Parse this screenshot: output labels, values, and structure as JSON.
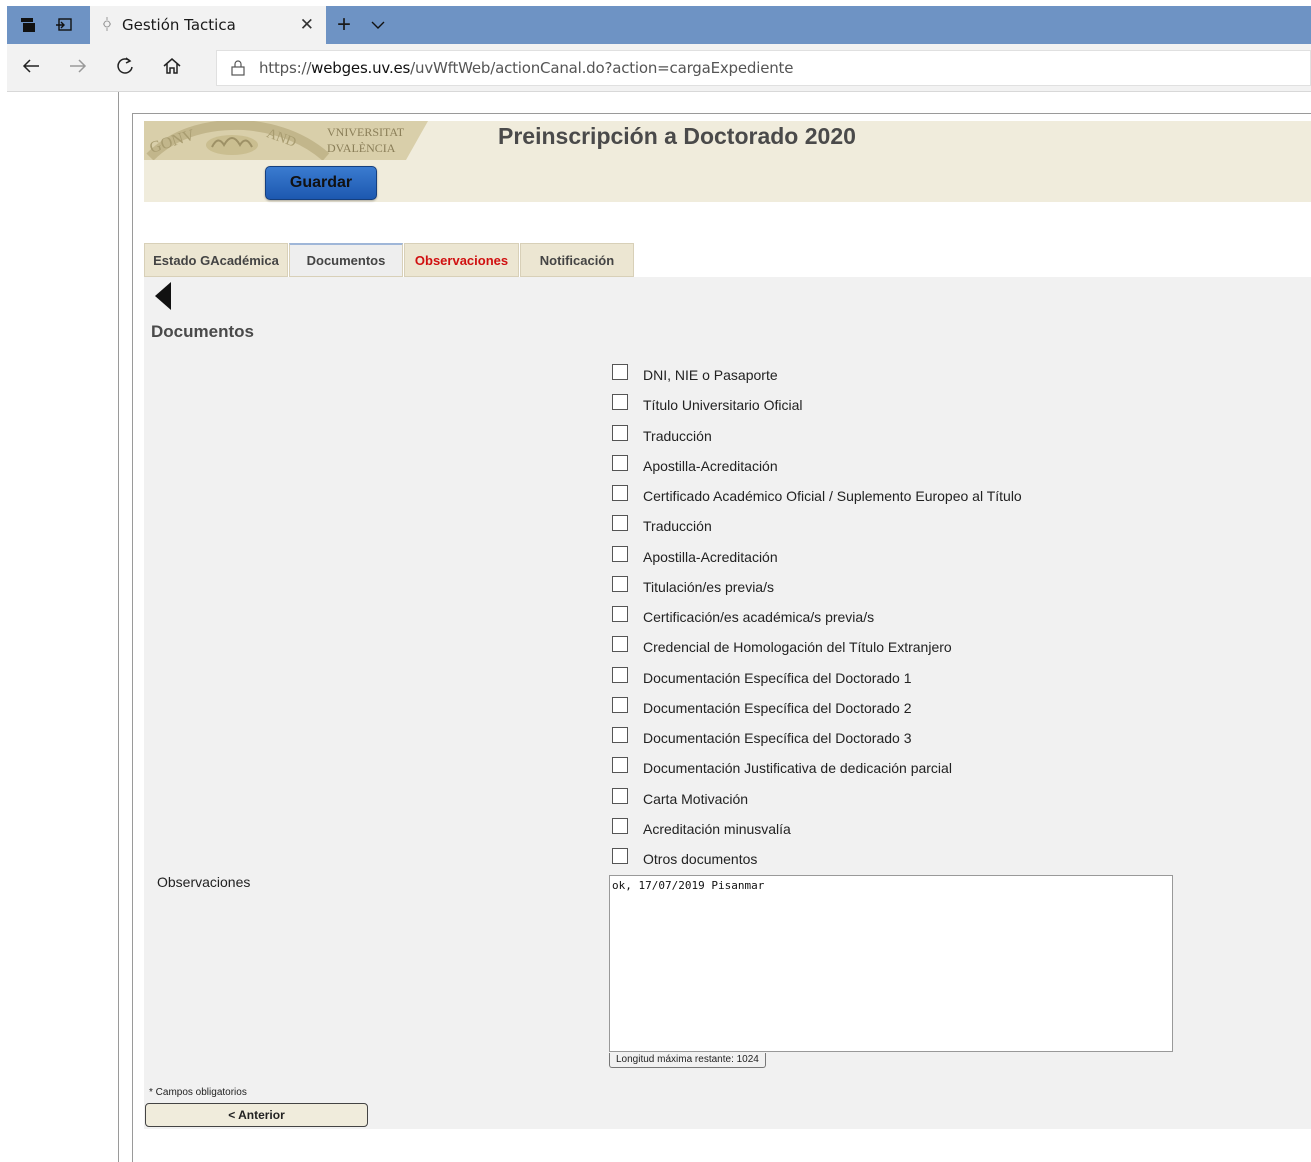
{
  "browser": {
    "tab_title": "Gestión Tactica",
    "new_tab_symbol": "+",
    "url_prefix": "https://",
    "url_host": "webges.uv.es",
    "url_path": "/uvWftWeb/actionCanal.do?action=cargaExpediente"
  },
  "header": {
    "logo_text_line1": "VNIVERSITAT",
    "logo_text_line2": "DVALÈNCIA",
    "page_title": "Preinscripción a Doctorado 2020",
    "save_label": "Guardar"
  },
  "tabs": [
    {
      "label": "Estado GAcadémica"
    },
    {
      "label": "Documentos"
    },
    {
      "label": "Observaciones"
    },
    {
      "label": "Notificación"
    }
  ],
  "section_title": "Documentos",
  "documents": [
    "DNI, NIE o Pasaporte",
    "Título Universitario Oficial",
    "Traducción",
    "Apostilla-Acreditación",
    "Certificado Académico Oficial / Suplemento Europeo al Título",
    "Traducción",
    "Apostilla-Acreditación",
    "Titulación/es previa/s",
    "Certificación/es académica/s previa/s",
    "Credencial de Homologación del Título Extranjero",
    "Documentación Específica del Doctorado 1",
    "Documentación Específica del Doctorado 2",
    "Documentación Específica del Doctorado 3",
    "Documentación Justificativa de dedicación parcial",
    "Carta Motivación",
    "Acreditación minusvalía",
    "Otros documentos"
  ],
  "observaciones": {
    "label": "Observaciones",
    "value": "ok, 17/07/2019 Pisanmar",
    "max_length_note": "Longitud máxima restante: 1024"
  },
  "required_note": "* Campos obligatorios",
  "back_button_label": "< Anterior",
  "colors": {
    "titlebar": "#6e93c4",
    "header_bg": "#f0ecdc",
    "save_button": "#2a6ac4",
    "active_tab_red": "#d01010"
  }
}
